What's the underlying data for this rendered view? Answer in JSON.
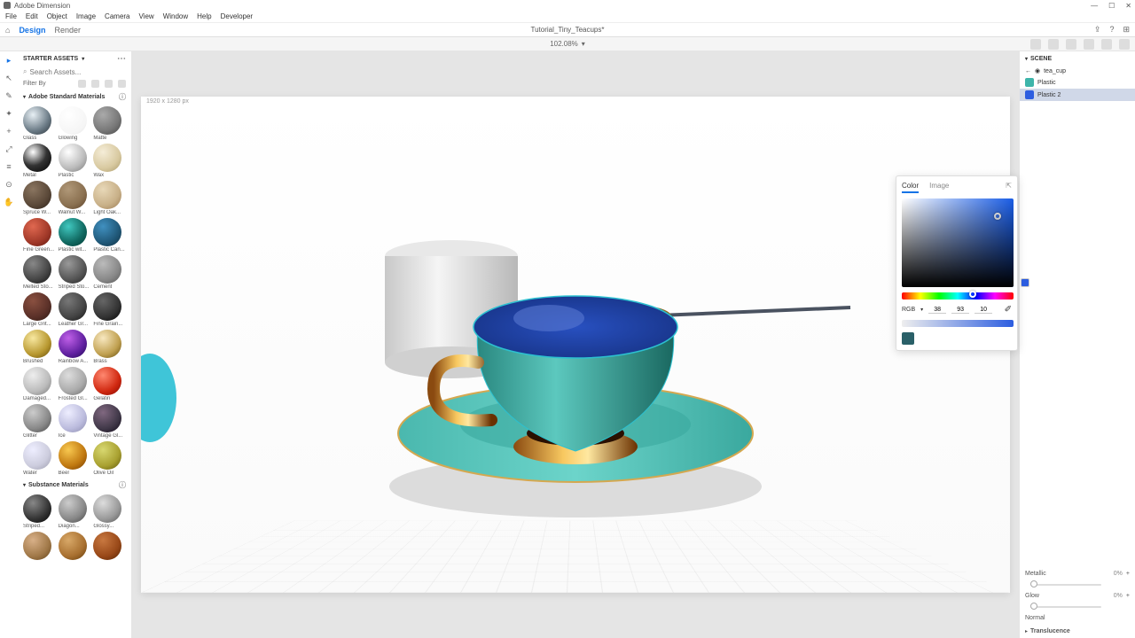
{
  "app": {
    "name": "Adobe Dimension"
  },
  "win": {
    "min": "—",
    "max": "☐",
    "close": "✕"
  },
  "menu": [
    "File",
    "Edit",
    "Object",
    "Image",
    "Camera",
    "View",
    "Window",
    "Help",
    "Developer"
  ],
  "modes": {
    "home": "⌂",
    "design": "Design",
    "render": "Render"
  },
  "doc": {
    "title": "Tutorial_Tiny_Teacups*",
    "zoom": "102.08%"
  },
  "assets": {
    "header": "STARTER ASSETS",
    "search_ph": "Search Assets...",
    "filter": "Filter By",
    "section1": "Adobe Standard Materials",
    "section2": "Substance Materials",
    "mats": [
      {
        "n": "Glass",
        "c": "radial-gradient(circle at 35% 30%,#e8f0f5,#6a7a85 60%,#2a3238)"
      },
      {
        "n": "Glowing",
        "c": "radial-gradient(circle at 35% 30%,#fff,#f5f5f5 70%,#e0e0e0)"
      },
      {
        "n": "Matte",
        "c": "radial-gradient(circle at 35% 30%,#aaa,#777 60%,#444)"
      },
      {
        "n": "Metal",
        "c": "radial-gradient(circle at 35% 30%,#fff,#333 50%,#000)"
      },
      {
        "n": "Plastic",
        "c": "radial-gradient(circle at 35% 30%,#fff,#bbb 60%,#777)"
      },
      {
        "n": "Wax",
        "c": "radial-gradient(circle at 35% 30%,#f5edd8,#d8c9a0 60%,#a89868)"
      },
      {
        "n": "Spruce W...",
        "c": "radial-gradient(circle at 35% 30%,#8a7560,#5a4838 60%,#2a2018)"
      },
      {
        "n": "Walnut W...",
        "c": "radial-gradient(circle at 35% 30%,#b09878,#8a7050 60%,#5a4028)"
      },
      {
        "n": "Light Oak...",
        "c": "radial-gradient(circle at 35% 30%,#e8d8b8,#c8b088 60%,#987850)"
      },
      {
        "n": "Fine Green...",
        "c": "radial-gradient(circle at 35% 30%,#e06850,#a03828 60%,#601810)"
      },
      {
        "n": "Plastic wit...",
        "c": "radial-gradient(circle at 35% 30%,#40c8c0,#106860 60%,#003830)"
      },
      {
        "n": "Plastic Can...",
        "c": "radial-gradient(circle at 35% 30%,#4090c0,#205878 60%,#103040)"
      },
      {
        "n": "Melted Sto...",
        "c": "radial-gradient(circle at 35% 30%,#888,#444 60%,#111)"
      },
      {
        "n": "Striped Sto...",
        "c": "radial-gradient(circle at 35% 30%,#999,#555 60%,#222)"
      },
      {
        "n": "Cement",
        "c": "radial-gradient(circle at 35% 30%,#bbb,#888 60%,#555)"
      },
      {
        "n": "Large Grit...",
        "c": "radial-gradient(circle at 35% 30%,#8a5040,#5a3028 60%,#2a1810)"
      },
      {
        "n": "Leather Gr...",
        "c": "radial-gradient(circle at 35% 30%,#777,#444 60%,#111)"
      },
      {
        "n": "Fine Grain...",
        "c": "radial-gradient(circle at 35% 30%,#666,#333 60%,#000)"
      },
      {
        "n": "Brushed",
        "c": "radial-gradient(circle at 35% 30%,#f8e8a0,#b89830 60%,#604808)"
      },
      {
        "n": "Rainbow A...",
        "c": "radial-gradient(circle at 35% 30%,#c060e8,#6020a0 60%,#200850)"
      },
      {
        "n": "Brass",
        "c": "radial-gradient(circle at 35% 30%,#f8e8c0,#c0a050 60%,#604808)"
      },
      {
        "n": "Damaged...",
        "c": "radial-gradient(circle at 35% 30%,#eee,#bbb 60%,#777)"
      },
      {
        "n": "Frosted Gl...",
        "c": "radial-gradient(circle at 35% 30%,#ddd,#aaa 60%,#666)"
      },
      {
        "n": "Gelatin",
        "c": "radial-gradient(circle at 35% 30%,#ff8870,#d02810 60%,#800800)"
      },
      {
        "n": "Glitter",
        "c": "radial-gradient(circle at 35% 30%,#ccc,#888 60%,#444)"
      },
      {
        "n": "Ice",
        "c": "radial-gradient(circle at 35% 30%,#eef,#bbd 60%,#88a)"
      },
      {
        "n": "Vintage Gl...",
        "c": "radial-gradient(circle at 35% 30%,#806880,#403848 60%,#100818)"
      },
      {
        "n": "Water",
        "c": "radial-gradient(circle at 35% 30%,#eef,#ccd 60%,#99a)"
      },
      {
        "n": "Beer",
        "c": "radial-gradient(circle at 35% 30%,#f8c850,#c07810 60%,#703800)"
      },
      {
        "n": "Olive Oil",
        "c": "radial-gradient(circle at 35% 30%,#d8d870,#a8a030 60%,#585008)"
      }
    ],
    "sub_mats": [
      {
        "n": "Striped...",
        "c": "radial-gradient(circle at 35% 30%,#888,#333 60%,#000)"
      },
      {
        "n": "Diagon...",
        "c": "radial-gradient(circle at 35% 30%,#ccc,#888 60%,#444)"
      },
      {
        "n": "Glossy...",
        "c": "radial-gradient(circle at 35% 30%,#ddd,#999 60%,#555)"
      },
      {
        "n": "",
        "c": "radial-gradient(circle at 35% 30%,#d8b088,#a07848 60%,#604018)"
      },
      {
        "n": "",
        "c": "radial-gradient(circle at 35% 30%,#d8a868,#a87030 60%,#603808)"
      },
      {
        "n": "",
        "c": "radial-gradient(circle at 35% 30%,#c87840,#984818 60%,#502000)"
      }
    ]
  },
  "canvas": {
    "dims": "1920 x 1280 px"
  },
  "scene": {
    "header": "SCENE",
    "back": "←",
    "obj": "tea_cup",
    "items": [
      {
        "label": "Plastic",
        "color": "#3eb5aa"
      },
      {
        "label": "Plastic 2",
        "color": "#2c5de0"
      }
    ]
  },
  "color": {
    "tab1": "Color",
    "tab2": "Image",
    "mode": "RGB",
    "r": "38",
    "g": "93",
    "b": "10",
    "swatch": "#2a6068",
    "metallic": "Metallic",
    "metallic_val": "0%",
    "glow": "Glow",
    "glow_val": "0%",
    "normal": "Normal",
    "trans": "Translucence"
  }
}
